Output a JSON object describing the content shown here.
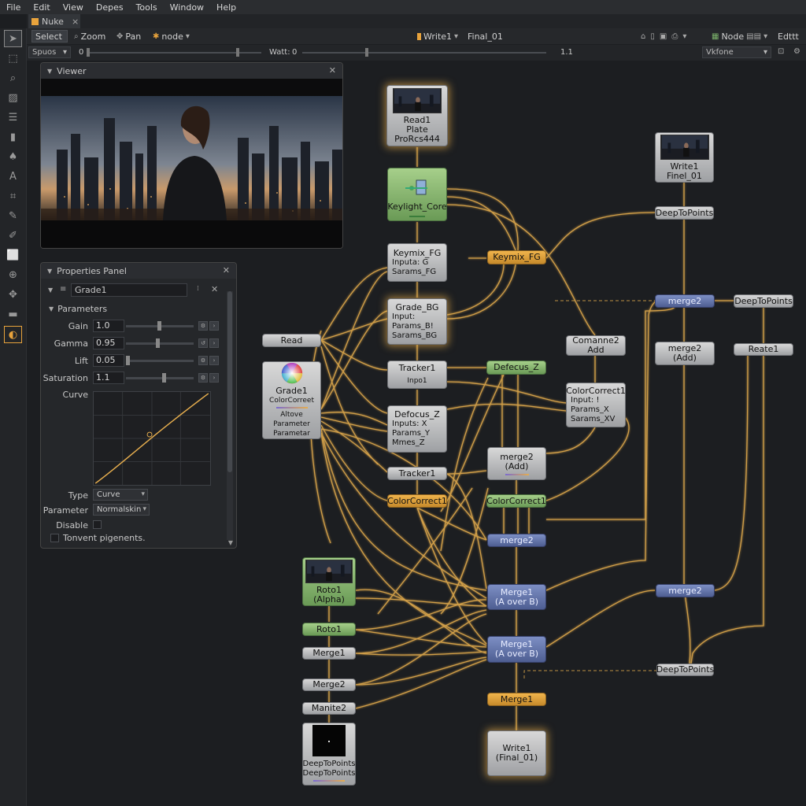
{
  "menu": [
    "File",
    "Edit",
    "View",
    "Depes",
    "Tools",
    "Window",
    "Help"
  ],
  "tab": {
    "title": "Nuke",
    "close": "×"
  },
  "toolbar": {
    "select": "Select",
    "zoom": "Zoom",
    "pan": "Pan",
    "node": "node",
    "write_node": "Write1",
    "final": "Final_01",
    "node_mode": "Node",
    "edit": "Edttt"
  },
  "toolbar2": {
    "spuos": "Spuos",
    "start": "0",
    "watt": "Watt:",
    "watt_val": "0",
    "end_val": "1.1",
    "viewer_select": "Vkfone"
  },
  "viewer": {
    "title": "Viewer"
  },
  "properties": {
    "title": "Properties Panel",
    "node_name": "Grade1",
    "section": "Parameters",
    "gain_label": "Gain",
    "gain": "1.0",
    "gamma_label": "Gamma",
    "gamma": "0.95",
    "lift_label": "Lift",
    "lift": "0.05",
    "saturation_label": "Saturation",
    "saturation": "1.1",
    "curve_label": "Curve",
    "type_label": "Type",
    "type_value": "Curve",
    "parameter_label": "Parameter",
    "parameter_value": "Normalskin",
    "disable_label": "Disable",
    "tonvent_label": "Tonvent pigenents."
  },
  "nodes": {
    "read1": [
      "Read1",
      "Plate",
      "ProRcs444"
    ],
    "keylight": "Keylight_Core",
    "keymix_fg": [
      "Keymix_FG",
      "Inputa: G",
      "Sarams_FG"
    ],
    "keymix_fg2": "Keymix_FG",
    "grade_bg": [
      "Grade_BG",
      "Input:",
      "Params_B!",
      "Sarams_BG"
    ],
    "read": "Read",
    "grade1": [
      "Grade1",
      "ColorCorreet",
      "Altove",
      "Parameter",
      "Parametar"
    ],
    "tracker1a": [
      "Tracker1",
      "Inpo1"
    ],
    "defocus_z_top": "Defecus_Z",
    "defocus_z": [
      "Defocus_Z",
      "Inputs: X",
      "Params_Y",
      "Mmes_Z"
    ],
    "tracker1b": "Tracker1",
    "colorcorrect1_o": "ColorCorrect1",
    "colorcorrect1_g": "ColorCorrect1",
    "comanne2": [
      "Comanne2",
      "Add"
    ],
    "colorcorrect1_box": [
      "ColorCorrect1",
      "Input: !",
      "Params_X",
      "Sarams_XV"
    ],
    "merge2_add_mid": [
      "merge2",
      "(Add)"
    ],
    "merge2_mid": "merge2",
    "write1_top": [
      "Write1",
      "Finel_01"
    ],
    "deeptopoints_top": "DeepToPoints",
    "merge2_right": "merge2",
    "deeptopoints_right": "DeepToPoints",
    "merge2_add_right": [
      "merge2",
      "(Add)"
    ],
    "reate1": "Reate1",
    "roto1_alpha": [
      "Roto1",
      "(Alpha)"
    ],
    "roto1": "Roto1",
    "merge1_small": "Merge1",
    "merge2_small": "Merge2",
    "manite2": "Manite2",
    "deeptopoints_bottom": [
      "DeepToPoints",
      "DeepToPoints"
    ],
    "merge1_aoverb_1": [
      "Merge1",
      "(A over B)"
    ],
    "merge1_aoverb_2": [
      "Merge1",
      "(A over B)"
    ],
    "merge2_lower_right": "merge2",
    "deeptopoints_lower": "DeepToPoints",
    "merge1_orange": "Merge1",
    "write1_final": [
      "Write1",
      "(Final_01)"
    ]
  }
}
